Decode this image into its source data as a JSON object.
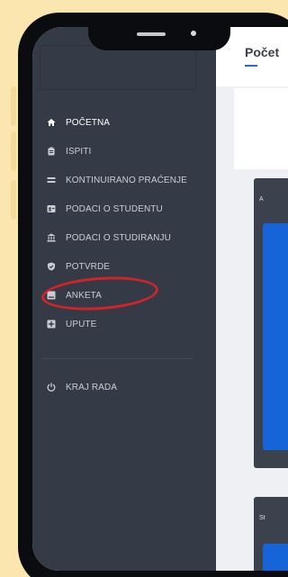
{
  "sidebar": {
    "items": [
      {
        "label": "POČETNA",
        "icon": "home-icon",
        "active": true
      },
      {
        "label": "ISPITI",
        "icon": "clipboard-icon",
        "active": false
      },
      {
        "label": "KONTINUIRANO PRAĆENJE",
        "icon": "list-icon",
        "active": false
      },
      {
        "label": "PODACI O STUDENTU",
        "icon": "id-card-icon",
        "active": false
      },
      {
        "label": "PODACI O STUDIRANJU",
        "icon": "university-icon",
        "active": false
      },
      {
        "label": "POTVRDE",
        "icon": "shield-check-icon",
        "active": false
      },
      {
        "label": "ANKETA",
        "icon": "poll-icon",
        "active": false
      },
      {
        "label": "UPUTE",
        "icon": "plus-square-icon",
        "active": false
      }
    ],
    "logout": {
      "label": "KRAJ RADA",
      "icon": "power-icon"
    }
  },
  "main": {
    "title": "Počet",
    "cards": [
      {
        "label": "A"
      },
      {
        "label": "St"
      }
    ]
  },
  "colors": {
    "sidebar": "#353b46",
    "accent": "#1565d8",
    "highlight": "#d2232a",
    "background": "#fbe6b0"
  }
}
